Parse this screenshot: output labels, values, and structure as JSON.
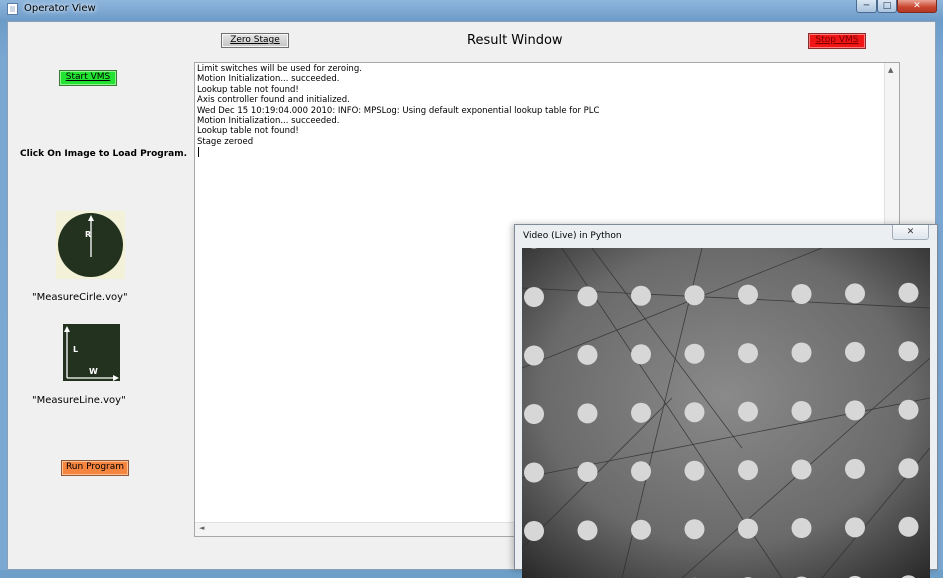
{
  "window": {
    "title": "Operator View",
    "controls": {
      "minimize": "─",
      "maximize": "□",
      "close": "✕"
    }
  },
  "toolbar": {
    "start_vms": "Start VMS",
    "zero_stage": "Zero Stage",
    "result_title": "Result Window",
    "stop_vms": "Stop VMS"
  },
  "left_panel": {
    "instruction": "Click On Image to Load Program.",
    "programs": [
      {
        "label": "\"MeasureCirle.voy\"",
        "icon": "circle-radius-icon",
        "icon_letter": "R"
      },
      {
        "label": "\"MeasureLine.voy\"",
        "icon": "line-lw-icon",
        "icon_letters": [
          "L",
          "W"
        ]
      }
    ],
    "run_program": "Run Program"
  },
  "log": {
    "lines": [
      "Limit switches will be used for zeroing.",
      "Motion Initialization... succeeded.",
      "Lookup table not found!",
      "Axis controller found and initialized.",
      "Wed Dec 15 10:19:04.000 2010: INFO: MPSLog: Using default exponential lookup table for PLC",
      "Motion Initialization... succeeded.",
      "Lookup table not found!",
      "Stage zeroed"
    ]
  },
  "video_window": {
    "title": "Video (Live) in Python",
    "close": "✕"
  },
  "colors": {
    "start_vms": "#22e332",
    "stop_vms": "#f01616",
    "run_program": "#f6853f",
    "thumb_bg": "#22321f"
  }
}
